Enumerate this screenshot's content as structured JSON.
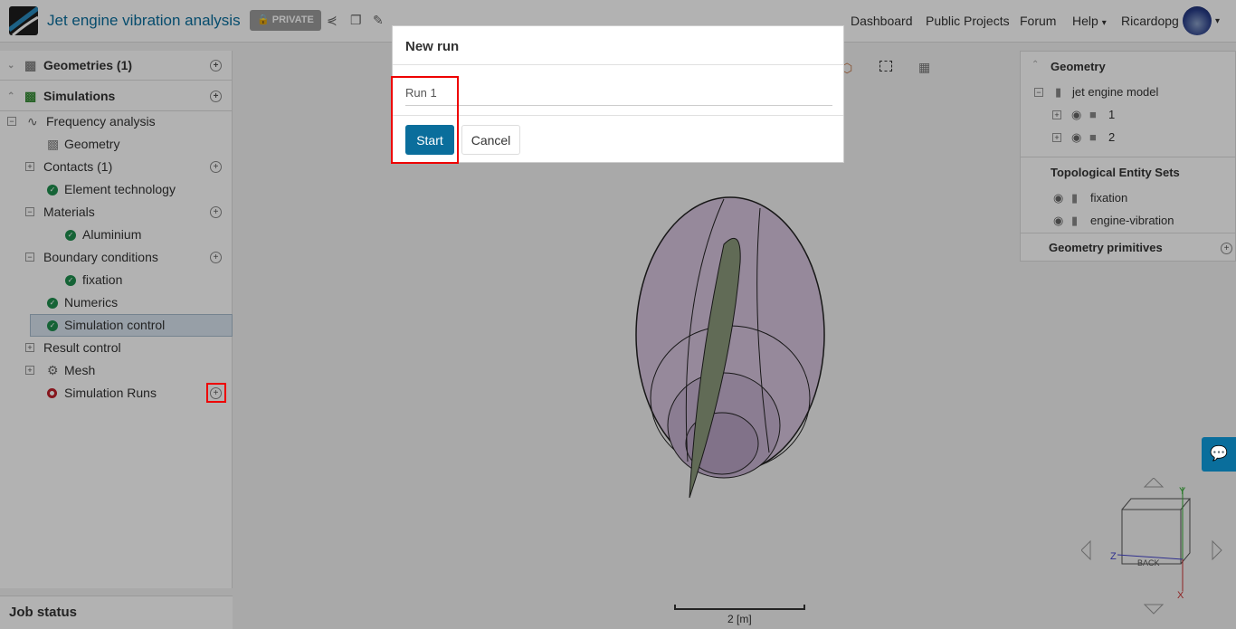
{
  "header": {
    "title": "Jet engine vibration analysis",
    "private_label": "PRIVATE",
    "nav": [
      "Dashboard",
      "Public Projects",
      "Forum",
      "Help",
      "Ricardopg"
    ]
  },
  "sidebar": {
    "geometries": "Geometries (1)",
    "simulations": "Simulations",
    "tree": [
      {
        "label": "Frequency analysis"
      },
      {
        "label": "Geometry"
      },
      {
        "label": "Contacts (1)"
      },
      {
        "label": "Element technology"
      },
      {
        "label": "Materials"
      },
      {
        "label": "Aluminium"
      },
      {
        "label": "Boundary conditions"
      },
      {
        "label": "fixation"
      },
      {
        "label": "Numerics"
      },
      {
        "label": "Simulation control"
      },
      {
        "label": "Result control"
      },
      {
        "label": "Mesh"
      },
      {
        "label": "Simulation Runs"
      }
    ],
    "job_status": "Job status"
  },
  "right_panel": {
    "geometry": "Geometry",
    "model": "jet engine model",
    "parts": [
      "1",
      "2"
    ],
    "topo": "Topological Entity Sets",
    "sets": [
      "fixation",
      "engine-vibration"
    ],
    "primitives": "Geometry primitives"
  },
  "viewport": {
    "scale_label": "2 [m]",
    "cube_face": "BACK",
    "axes": [
      "Y",
      "Z",
      "X"
    ]
  },
  "dialog": {
    "title": "New run",
    "name_value": "Run 1",
    "start": "Start",
    "cancel": "Cancel"
  },
  "colors": {
    "accent": "#0a6e9c",
    "highlight": "#ee0000"
  }
}
